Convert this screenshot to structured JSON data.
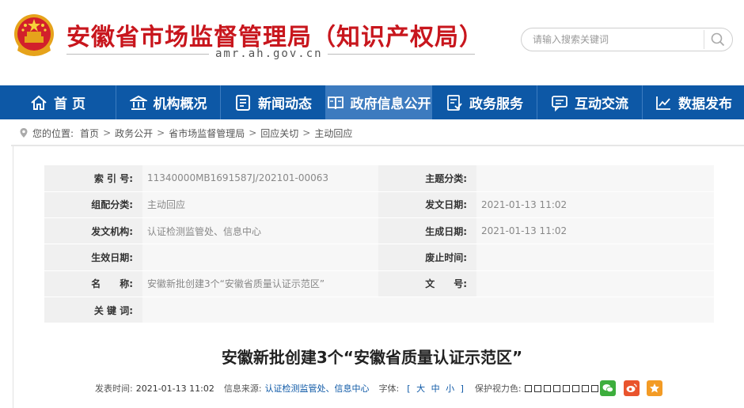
{
  "header": {
    "site_title": "安徽省市场监督管理局（知识产权局）",
    "domain": "amr.ah.gov.cn",
    "search_placeholder": "请输入搜索关键词"
  },
  "nav": {
    "items": [
      {
        "label": "首 页",
        "icon": "home-icon"
      },
      {
        "label": "机构概况",
        "icon": "institution-icon"
      },
      {
        "label": "新闻动态",
        "icon": "news-icon"
      },
      {
        "label": "政府信息公开",
        "icon": "open-book-icon"
      },
      {
        "label": "政务服务",
        "icon": "service-doc-icon"
      },
      {
        "label": "互动交流",
        "icon": "chat-icon"
      },
      {
        "label": "数据发布",
        "icon": "line-chart-icon"
      }
    ],
    "active_index": 3
  },
  "breadcrumb": {
    "prefix": "您的位置:",
    "items": [
      "首页",
      "政务公开",
      "省市场监督管理局",
      "回应关切",
      "主动回应"
    ]
  },
  "meta": {
    "rows": [
      {
        "left_label": "索 引 号:",
        "left_value": "11340000MB1691587J/202101-00063",
        "right_label": "主题分类:",
        "right_value": ""
      },
      {
        "left_label": "组配分类:",
        "left_value": "主动回应",
        "right_label": "发文日期:",
        "right_value": "2021-01-13 11:02"
      },
      {
        "left_label": "发文机构:",
        "left_value": "认证检测监管处、信息中心",
        "right_label": "生成日期:",
        "right_value": "2021-01-13 11:02"
      },
      {
        "left_label": "生效日期:",
        "left_value": "",
        "right_label": "废止时间:",
        "right_value": ""
      },
      {
        "left_label": "名　　称:",
        "left_value": "安徽新批创建3个“安徽省质量认证示范区”",
        "right_label": "文　　号:",
        "right_value": ""
      },
      {
        "left_label": "关 键 词:",
        "left_value": ""
      }
    ]
  },
  "article": {
    "title": "安徽新批创建3个“安徽省质量认证示范区”",
    "publish_label": "发表时间:",
    "publish_time": "2021-01-13 11:02",
    "source_label": "信息来源:",
    "source": "认证检测监管处、信息中心",
    "font_label": "字体:",
    "font_sizes": {
      "open": "[",
      "large": "大",
      "medium": "中",
      "small": "小",
      "close": "]"
    },
    "eye_label": "保护视力色:"
  },
  "colors": {
    "brand_red": "#c8161d",
    "nav_blue": "#0d58a6",
    "nav_active": "#3d7bbf"
  }
}
